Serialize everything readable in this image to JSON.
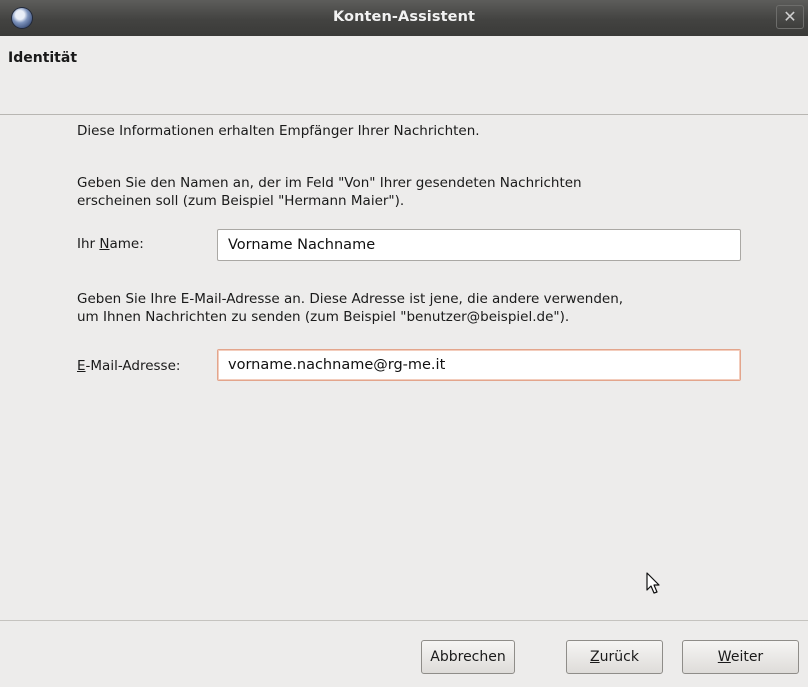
{
  "window": {
    "title": "Konten-Assistent",
    "close_glyph": "✕"
  },
  "header": {
    "title": "Identität"
  },
  "content": {
    "intro": "Diese Informationen erhalten Empfänger Ihrer Nachrichten.",
    "name_hint_line1": "Geben Sie den Namen an, der im Feld \"Von\" Ihrer gesendeten Nachrichten",
    "name_hint_line2": "erscheinen soll (zum Beispiel \"Hermann Maier\").",
    "name_label_pre": "Ihr ",
    "name_label_accel": "N",
    "name_label_post": "ame:",
    "name_value": "Vorname Nachname",
    "email_hint_line1": "Geben Sie Ihre E-Mail-Adresse an. Diese Adresse ist jene, die andere verwenden,",
    "email_hint_line2": "um Ihnen Nachrichten zu senden (zum Beispiel \"benutzer@beispiel.de\").",
    "email_label_accel": "E",
    "email_label_post": "-Mail-Adresse:",
    "email_value": "vorname.nachname@rg-me.it"
  },
  "buttons": {
    "cancel": "Abbrechen",
    "back_accel": "Z",
    "back_rest": "urück",
    "next_accel": "W",
    "next_rest": "eiter"
  },
  "icons": {
    "app": "thunderbird-app-icon",
    "close": "close-icon",
    "cursor": "mouse-pointer-icon"
  }
}
